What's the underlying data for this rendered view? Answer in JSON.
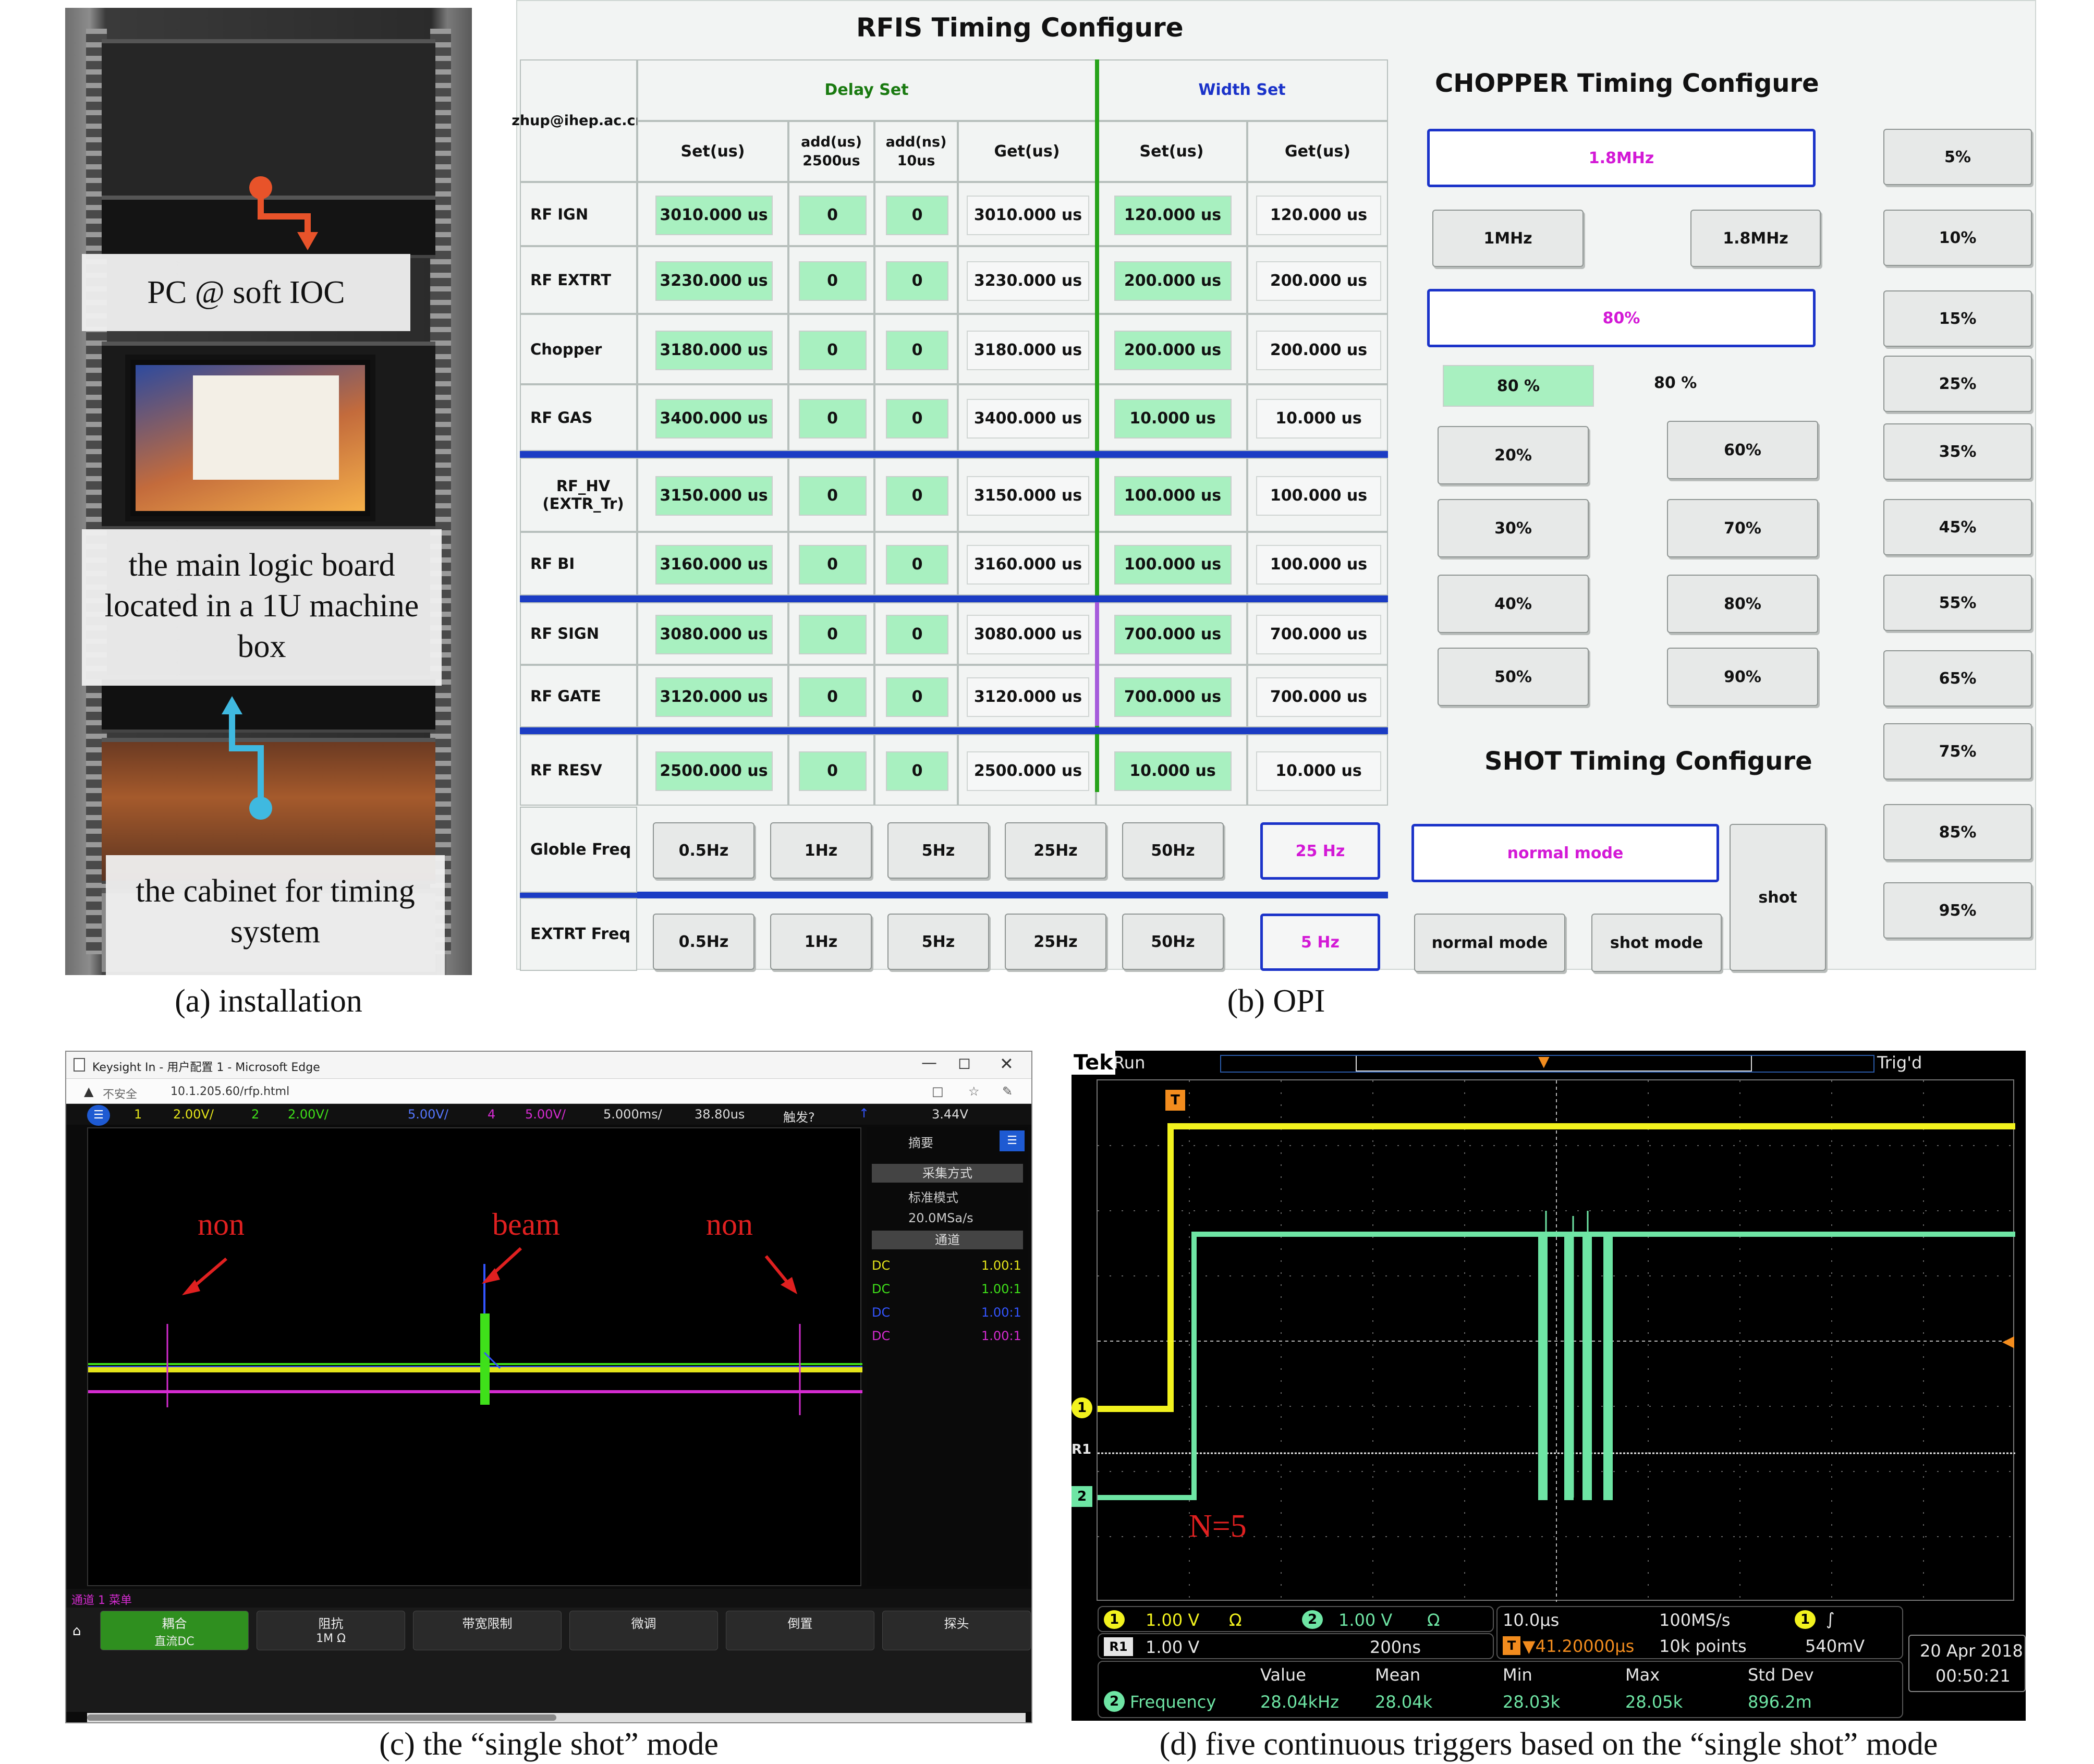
{
  "panel_a": {
    "label_pc": "PC @ soft IOC",
    "label_board": "the main logic board located in a 1U machine box",
    "label_cabinet": "the cabinet for timing system",
    "colors": {
      "arrow_top": "#e8532a",
      "arrow_bottom": "#3fb9e0"
    }
  },
  "captions": {
    "a": "(a) installation",
    "b": "(b) OPI",
    "c": "(c) the “single shot” mode",
    "d": "(d) five continuous triggers based on the “single shot” mode"
  },
  "opi": {
    "rfis_title": "RFIS Timing Configure",
    "chopper_title": "CHOPPER Timing Configure",
    "shot_title": "SHOT Timing Configure",
    "email": "zhup@ihep.ac.cn",
    "delay_set": "Delay Set",
    "width_set": "Width Set",
    "headers": [
      "Set(us)",
      "add(us) 2500us",
      "add(ns) 10us",
      "Get(us)",
      "Set(us)",
      "Get(us)"
    ],
    "rows": [
      {
        "label": "RF IGN",
        "d_set": "3010.000 us",
        "add_us": "0",
        "add_ns": "0",
        "d_get": "3010.000 us",
        "w_set": "120.000 us",
        "w_get": "120.000 us"
      },
      {
        "label": "RF EXTRT",
        "d_set": "3230.000 us",
        "add_us": "0",
        "add_ns": "0",
        "d_get": "3230.000 us",
        "w_set": "200.000 us",
        "w_get": "200.000 us"
      },
      {
        "label": "Chopper",
        "d_set": "3180.000 us",
        "add_us": "0",
        "add_ns": "0",
        "d_get": "3180.000 us",
        "w_set": "200.000 us",
        "w_get": "200.000 us"
      },
      {
        "label": "RF GAS",
        "d_set": "3400.000 us",
        "add_us": "0",
        "add_ns": "0",
        "d_get": "3400.000 us",
        "w_set": "10.000 us",
        "w_get": "10.000 us"
      },
      {
        "label": "RF_HV (EXTR_Tr)",
        "d_set": "3150.000 us",
        "add_us": "0",
        "add_ns": "0",
        "d_get": "3150.000 us",
        "w_set": "100.000 us",
        "w_get": "100.000 us"
      },
      {
        "label": "RF BI",
        "d_set": "3160.000 us",
        "add_us": "0",
        "add_ns": "0",
        "d_get": "3160.000 us",
        "w_set": "100.000 us",
        "w_get": "100.000 us"
      },
      {
        "label": "RF SIGN",
        "d_set": "3080.000 us",
        "add_us": "0",
        "add_ns": "0",
        "d_get": "3080.000 us",
        "w_set": "700.000 us",
        "w_get": "700.000 us"
      },
      {
        "label": "RF GATE",
        "d_set": "3120.000 us",
        "add_us": "0",
        "add_ns": "0",
        "d_get": "3120.000 us",
        "w_set": "700.000 us",
        "w_get": "700.000 us"
      },
      {
        "label": "RF RESV",
        "d_set": "2500.000 us",
        "add_us": "0",
        "add_ns": "0",
        "d_get": "2500.000 us",
        "w_set": "10.000 us",
        "w_get": "10.000 us"
      }
    ],
    "globle_freq": {
      "label": "Globle Freq",
      "buttons": [
        "0.5Hz",
        "1Hz",
        "5Hz",
        "25Hz",
        "50Hz"
      ],
      "selected": "25 Hz"
    },
    "extrt_freq": {
      "label": "EXTRT Freq",
      "buttons": [
        "0.5Hz",
        "1Hz",
        "5Hz",
        "25Hz",
        "50Hz"
      ],
      "selected": "5 Hz"
    },
    "chopper": {
      "freq_selected": "1.8MHz",
      "freq_buttons": [
        "1MHz",
        "1.8MHz"
      ],
      "duty_selected": "80%",
      "duty_set": "80 %",
      "duty_get": "80 %",
      "duty_buttons_left": [
        "20%",
        "30%",
        "40%",
        "50%"
      ],
      "duty_buttons_right": [
        "60%",
        "70%",
        "80%",
        "90%"
      ],
      "percent_column": [
        "5%",
        "10%",
        "15%",
        "25%",
        "35%",
        "45%",
        "55%",
        "65%",
        "75%",
        "85%",
        "95%"
      ]
    },
    "shot": {
      "selected": "normal mode",
      "buttons": [
        "normal mode",
        "shot mode"
      ],
      "status": "shot"
    },
    "colors": {
      "green_field": "#a8f0c0",
      "selected_border": "#1b33c9",
      "selected_text": "#d319d6",
      "blue_divider": "#1b3cc4",
      "green_divider": "#27a31a",
      "purple_divider": "#a55bdb",
      "delay_text": "#1a7a10",
      "width_text": "#1b33c9"
    }
  },
  "scope_c": {
    "window_title": "Keysight In - 用户配置 1 - Microsoft Edge",
    "insecure": "不安全",
    "url": "10.1.205.60/rfp.html",
    "ch1": "1",
    "ch1_scale": "2.00V/",
    "ch2": "2",
    "ch2_scale": "2.00V/",
    "ch3_scale": "5.00V/",
    "ch4": "4",
    "ch4_scale": "5.00V/",
    "timebase": "5.000ms/",
    "delay": "38.80us",
    "trigger_label": "触发?",
    "trigger_level": "3.44V",
    "side_summary": "摘要",
    "side_acq": "采集方式",
    "side_mode": "标准模式",
    "side_rate": "20.0MSa/s",
    "side_channel": "通道",
    "channel_rows": [
      {
        "coupling": "DC",
        "value": "1.00:1",
        "color": "#e5e51a"
      },
      {
        "coupling": "DC",
        "value": "1.00:1",
        "color": "#3fe01a"
      },
      {
        "coupling": "DC",
        "value": "1.00:1",
        "color": "#3355ff"
      },
      {
        "coupling": "DC",
        "value": "1.00:1",
        "color": "#d42bd0"
      }
    ],
    "annot_left": "non",
    "annot_mid": "beam",
    "annot_right": "non",
    "bottom_header": "通道 1 菜单",
    "softkeys": [
      {
        "label": "耦合",
        "value": "直流DC"
      },
      {
        "label": "阻抗",
        "value": "1M Ω"
      },
      {
        "label": "带宽限制",
        "value": ""
      },
      {
        "label": "微调",
        "value": ""
      },
      {
        "label": "倒置",
        "value": ""
      },
      {
        "label": "探头",
        "value": ""
      }
    ],
    "colors": {
      "ch_yellow": "#e5e51a",
      "ch_green": "#3fe01a",
      "ch_blue": "#3355ff",
      "ch_magenta": "#d42bd0",
      "annot_red": "#e02020"
    }
  },
  "scope_d": {
    "brand": "Tek",
    "status": "Run",
    "trig_status": "Trig'd",
    "annot": "N=5",
    "ch1_badge": "1",
    "ch1_scale": "1.00 V",
    "ch2_badge": "2",
    "ch2_scale": "1.00 V",
    "r1_badge": "R1",
    "r1_scale": "1.00 V",
    "r1_time": "200ns",
    "timebase": "10.0μs",
    "sample_rate": "100MS/s",
    "trigger_offset": "▼41.20000μs",
    "record_length": "10k points",
    "trig_level": "540mV",
    "date": "20 Apr 2018",
    "time": "00:50:21",
    "measure": {
      "name": "Frequency",
      "headers": [
        "Value",
        "Mean",
        "Min",
        "Max",
        "Std Dev"
      ],
      "values": [
        "28.04kHz",
        "28.04k",
        "28.03k",
        "28.05k",
        "896.2m"
      ]
    },
    "colors": {
      "ch1": "#f2f21e",
      "ch2": "#6ee5a4",
      "ref": "#e6e6e6",
      "trigger": "#f28c1e",
      "annot": "#e02020"
    }
  }
}
